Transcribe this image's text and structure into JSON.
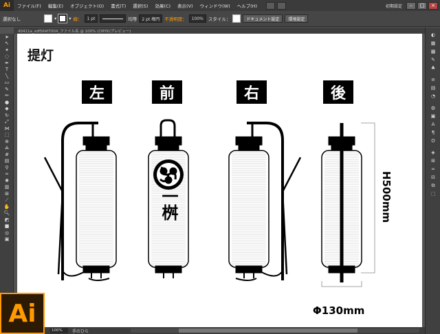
{
  "app": {
    "logo_small": "Ai",
    "logo_big": "Ai"
  },
  "menu": {
    "items": [
      "ファイル(F)",
      "編集(E)",
      "オブジェクト(O)",
      "書式(T)",
      "選択(S)",
      "効果(C)",
      "表示(V)",
      "ウィンドウ(W)",
      "ヘルプ(H)"
    ],
    "workspace": "初期設定"
  },
  "control": {
    "selection_label": "選択なし",
    "stroke_label": "線：",
    "stroke_weight": "1 pt",
    "profile": "均等",
    "brush": "2 pt 楕円",
    "opacity_label": "不透明度：",
    "opacity_value": "100%",
    "style_label": "スタイル：",
    "doc_settings": "ドキュメント設定",
    "preferences": "環境設定"
  },
  "document": {
    "tab": "40411a_sdf564f7004_ファイル名 @ 100% (CMYK/プレビュー)"
  },
  "status": {
    "zoom": "100%",
    "tool_label": "手のひら"
  },
  "artwork": {
    "title": "提灯",
    "views": [
      "左",
      "前",
      "右",
      "後"
    ],
    "lantern_text": "一桝",
    "height_label": "H500mm",
    "diameter_label": "Φ130mm"
  },
  "colors": {
    "accent": "#ff9a00",
    "ui_dark": "#535353"
  }
}
